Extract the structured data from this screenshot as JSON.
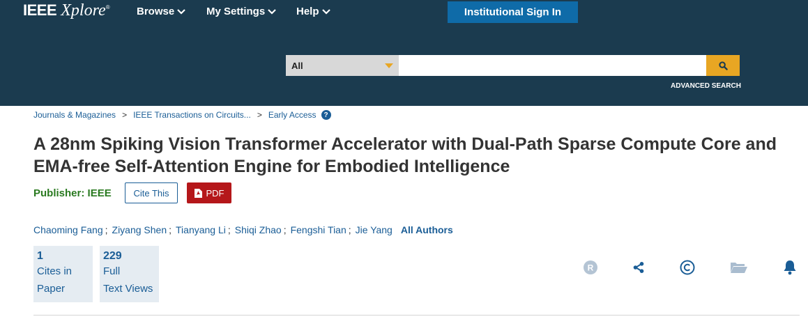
{
  "header": {
    "logo_main": "IEEE",
    "logo_sub": "Xplore",
    "logo_reg": "®",
    "nav": [
      {
        "label": "Browse"
      },
      {
        "label": "My Settings"
      },
      {
        "label": "Help"
      }
    ],
    "signin_label": "Institutional Sign In",
    "search": {
      "scope_value": "All",
      "placeholder": "",
      "value": ""
    },
    "advanced_search_label": "ADVANCED SEARCH"
  },
  "breadcrumb": {
    "items": [
      "Journals & Magazines",
      "IEEE Transactions on Circuits...",
      "Early Access"
    ],
    "separator": ">",
    "help_glyph": "?"
  },
  "article": {
    "title": "A 28nm Spiking Vision Transformer Accelerator with Dual-Path Sparse Compute Core and EMA-free Self-Attention Engine for Embodied Intelligence",
    "publisher_label": "Publisher:",
    "publisher_value": "IEEE",
    "cite_label": "Cite This",
    "pdf_label": "PDF",
    "authors": [
      "Chaoming Fang",
      "Ziyang Shen",
      "Tianyang Li",
      "Shiqi Zhao",
      "Fengshi Tian",
      "Jie Yang"
    ],
    "author_separator": ";",
    "all_authors_label": "All Authors"
  },
  "metrics": [
    {
      "value": "1",
      "line1": "Cites in",
      "line2": "Paper"
    },
    {
      "value": "229",
      "line1": "Full",
      "line2": "Text Views"
    }
  ],
  "actions": [
    {
      "icon": "rights-icon"
    },
    {
      "icon": "share-icon"
    },
    {
      "icon": "copyright-icon"
    },
    {
      "icon": "folder-icon"
    },
    {
      "icon": "alert-bell-icon"
    }
  ],
  "colors": {
    "header_bg": "#1b3b4f",
    "signin_bg": "#0f6ba8",
    "accent_orange": "#e8a623",
    "link_blue": "#1a5d96",
    "publisher_green": "#2a7a20",
    "pdf_red": "#b5171a",
    "metric_bg": "#e5ecf2"
  }
}
